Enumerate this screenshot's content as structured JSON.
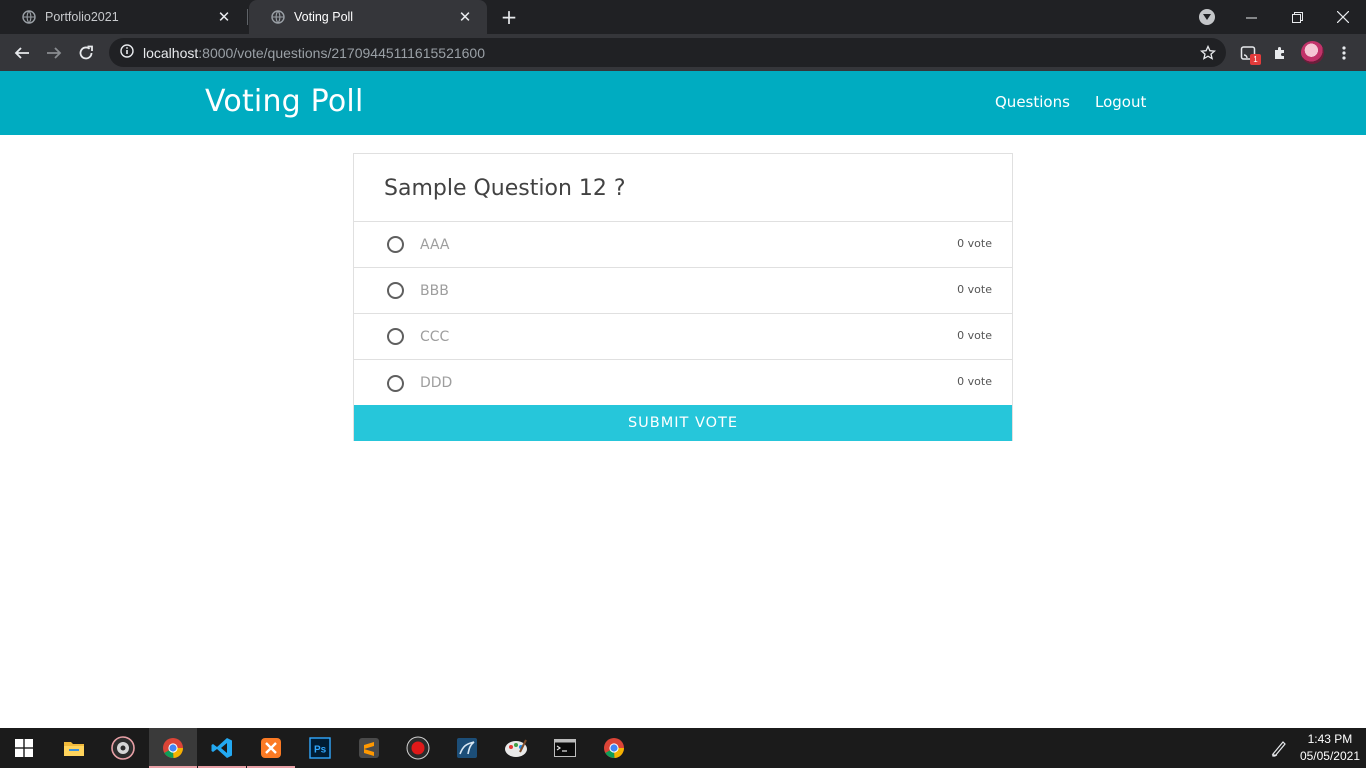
{
  "browser": {
    "tabs": [
      {
        "title": "Portfolio2021",
        "active": false
      },
      {
        "title": "Voting Poll",
        "active": true
      }
    ],
    "url_host": "localhost",
    "url_path": ":8000/vote/questions/21709445111615521600",
    "extension_badge": "1"
  },
  "app": {
    "brand": "Voting Poll",
    "nav": {
      "questions": "Questions",
      "logout": "Logout"
    },
    "accent_color": "#00acc1",
    "button_color": "#26c6da"
  },
  "poll": {
    "question": "Sample Question 12 ?",
    "options": [
      {
        "label": "AAA",
        "votes": "0 vote"
      },
      {
        "label": "BBB",
        "votes": "0 vote"
      },
      {
        "label": "CCC",
        "votes": "0 vote"
      },
      {
        "label": "DDD",
        "votes": "0 vote"
      }
    ],
    "submit_label": "SUBMIT VOTE"
  },
  "taskbar": {
    "apps": [
      "start-icon",
      "file-explorer-icon",
      "media-app-icon",
      "chrome-icon",
      "vscode-icon",
      "xampp-icon",
      "photoshop-icon",
      "sublime-text-icon",
      "screen-recorder-icon",
      "mysql-workbench-icon",
      "paint-icon",
      "terminal-icon",
      "chrome-icon"
    ],
    "time": "1:43 PM",
    "date": "05/05/2021"
  }
}
